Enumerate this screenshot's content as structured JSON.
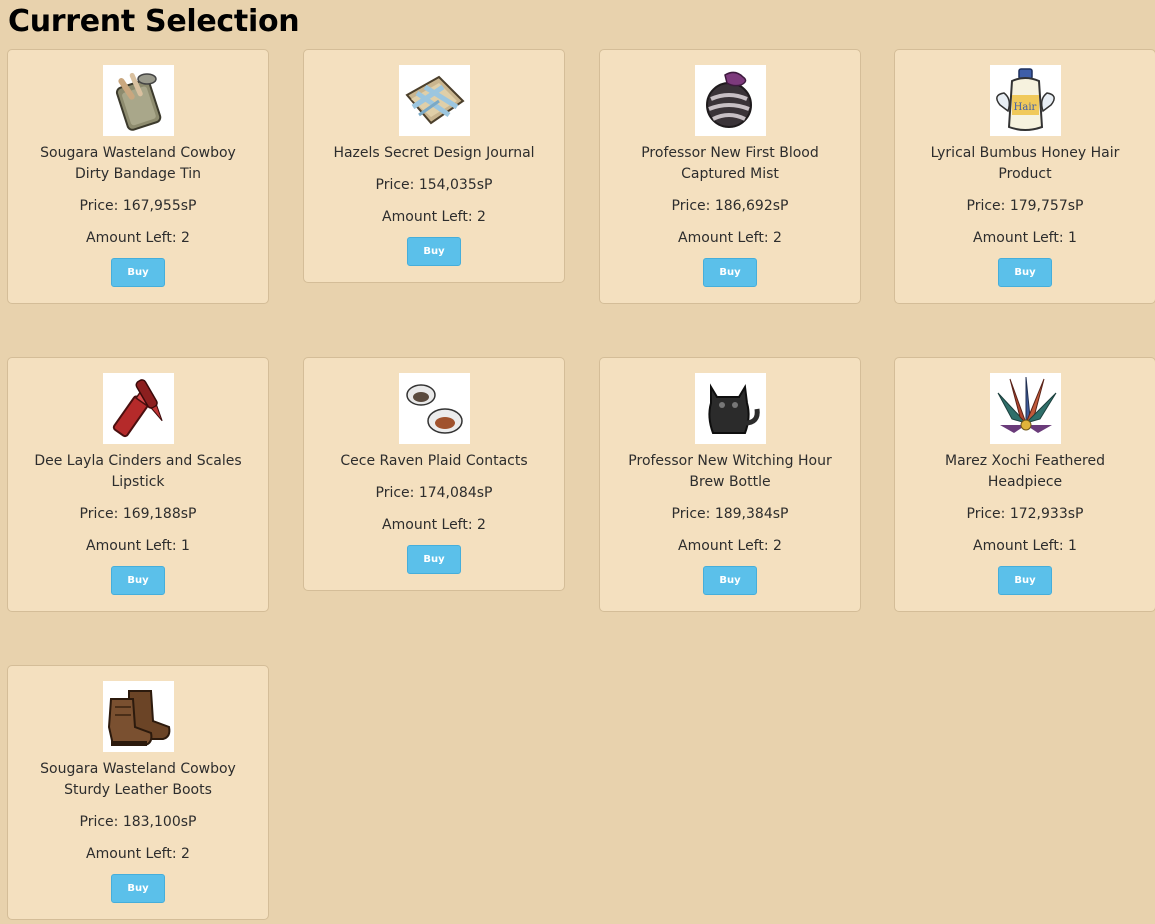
{
  "page": {
    "title": "Current Selection"
  },
  "items": [
    {
      "name": "Sougara Wasteland Cowboy Dirty Bandage Tin",
      "price": "Price: 167,955sP",
      "amount": "Amount Left: 2",
      "buy_label": "Buy",
      "icon": "bandage-tin-icon"
    },
    {
      "name": "Hazels Secret Design Journal",
      "price": "Price: 154,035sP",
      "amount": "Amount Left: 2",
      "buy_label": "Buy",
      "icon": "design-journal-icon"
    },
    {
      "name": "Professor New First Blood Captured Mist",
      "price": "Price: 186,692sP",
      "amount": "Amount Left: 2",
      "buy_label": "Buy",
      "icon": "captured-mist-icon"
    },
    {
      "name": "Lyrical Bumbus Honey Hair Product",
      "price": "Price: 179,757sP",
      "amount": "Amount Left: 1",
      "buy_label": "Buy",
      "icon": "hair-product-bottle-icon"
    },
    {
      "name": "Dee Layla Cinders and Scales Lipstick",
      "price": "Price: 169,188sP",
      "amount": "Amount Left: 1",
      "buy_label": "Buy",
      "icon": "lipstick-icon"
    },
    {
      "name": "Cece Raven Plaid Contacts",
      "price": "Price: 174,084sP",
      "amount": "Amount Left: 2",
      "buy_label": "Buy",
      "icon": "contact-lenses-icon"
    },
    {
      "name": "Professor New Witching Hour Brew Bottle",
      "price": "Price: 189,384sP",
      "amount": "Amount Left: 2",
      "buy_label": "Buy",
      "icon": "cat-bottle-icon"
    },
    {
      "name": "Marez Xochi Feathered Headpiece",
      "price": "Price: 172,933sP",
      "amount": "Amount Left: 1",
      "buy_label": "Buy",
      "icon": "feathered-headpiece-icon"
    },
    {
      "name": "Sougara Wasteland Cowboy Sturdy Leather Boots",
      "price": "Price: 183,100sP",
      "amount": "Amount Left: 2",
      "buy_label": "Buy",
      "icon": "leather-boots-icon"
    }
  ],
  "colors": {
    "background": "#e8d2ad",
    "card": "#f4e0bf",
    "button": "#5bc0ea"
  }
}
